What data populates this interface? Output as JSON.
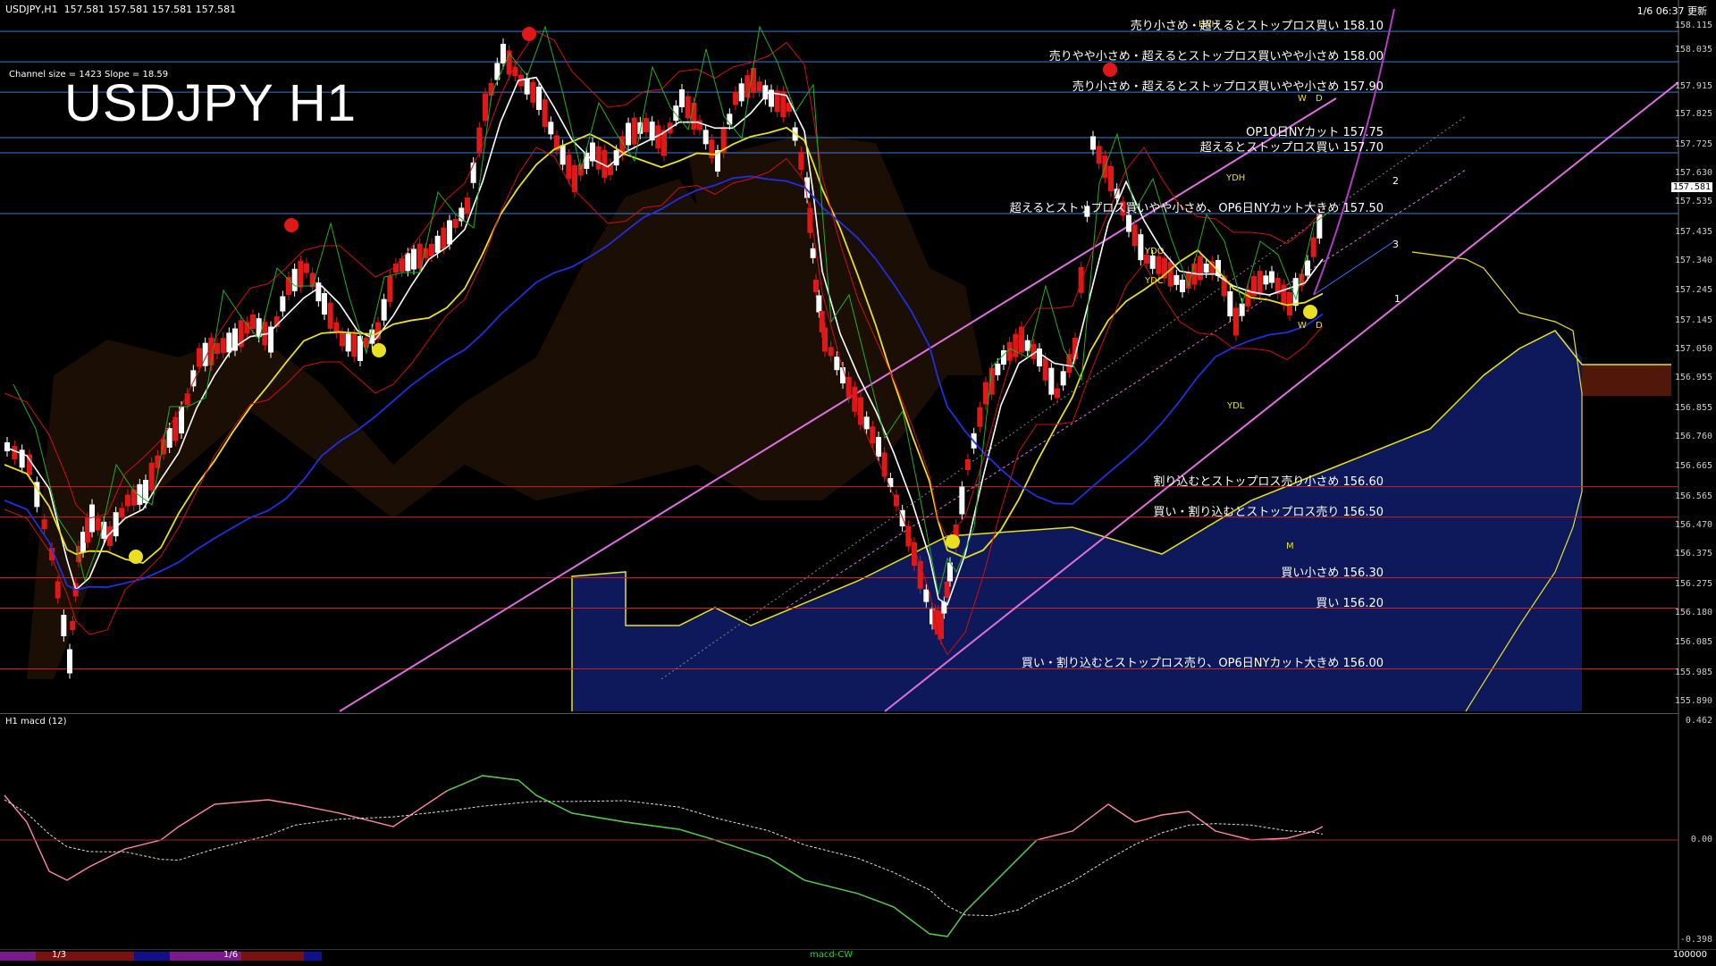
{
  "window": {
    "symbol_header": "USDJPY,H1",
    "ohlc": "157.581 157.581 157.581 157.581",
    "title": "USDJPY H1",
    "datetime": "1/6 06:37 更新",
    "channel_info": "Channel size = 1423 Slope = 18.59"
  },
  "levels": [
    {
      "text": "売り小さめ・超えるとストップロス買い 158.10",
      "price": 158.1,
      "color": "#3a7bd5"
    },
    {
      "text": "売りやや小さめ・超えるとストップロス買いやや小さめ 158.00",
      "price": 158.0,
      "color": "#3a7bd5"
    },
    {
      "text": "売り小さめ・超えるとストップロス買いやや小さめ 157.90",
      "price": 157.9,
      "color": "#3a7bd5"
    },
    {
      "text": "OP10日NYカット 157.75",
      "price": 157.75,
      "color": "#3a7bd5"
    },
    {
      "text": "超えるとストップロス買い 157.70",
      "price": 157.7,
      "color": "#3a7bd5"
    },
    {
      "text": "超えるとストップロス買いやや小さめ、OP6日NYカット大きめ 157.50",
      "price": 157.5,
      "color": "#3a7bd5"
    },
    {
      "text": "割り込むとストップロス売り小さめ 156.60",
      "price": 156.6,
      "color": "#cc2222"
    },
    {
      "text": "買い・割り込むとストップロス売り 156.50",
      "price": 156.5,
      "color": "#cc2222"
    },
    {
      "text": "買い小さめ 156.30",
      "price": 156.3,
      "color": "#cc2222"
    },
    {
      "text": "買い 156.20",
      "price": 156.2,
      "color": "#cc2222"
    },
    {
      "text": "買い・割り込むとストップロス売り、OP6日NYカット大きめ 156.00",
      "price": 156.0,
      "color": "#cc2222"
    }
  ],
  "price_axis": [
    "158.115",
    "158.035",
    "157.915",
    "157.825",
    "157.725",
    "157.630",
    "157.535",
    "157.435",
    "157.340",
    "157.245",
    "157.145",
    "157.050",
    "156.955",
    "156.855",
    "156.760",
    "156.665",
    "156.565",
    "156.470",
    "156.375",
    "156.275",
    "156.180",
    "156.085",
    "155.985",
    "155.890"
  ],
  "current_price": "157.581",
  "subwindow": {
    "title": "H1 macd (12)",
    "axis": [
      "0.462",
      "0.00",
      "-0.398"
    ]
  },
  "markers": {
    "ydh": "YDH",
    "ydl": "YDL",
    "ydo": "YDO",
    "ydc": "YDC",
    "lwh": "LWH",
    "w": "W",
    "d": "D",
    "m": "M",
    "n1": "1",
    "n2": "2",
    "n3": "3"
  },
  "tabs": {
    "t1": "1/3",
    "t2": "1/6",
    "t3": "macd-CW",
    "scale": "100000"
  },
  "colors": {
    "buy_line": "#3a7bd5",
    "sell_line": "#cc2222",
    "channel": "#e070e0",
    "kumo": "#1a2a8a",
    "span": "#e8e020"
  }
}
